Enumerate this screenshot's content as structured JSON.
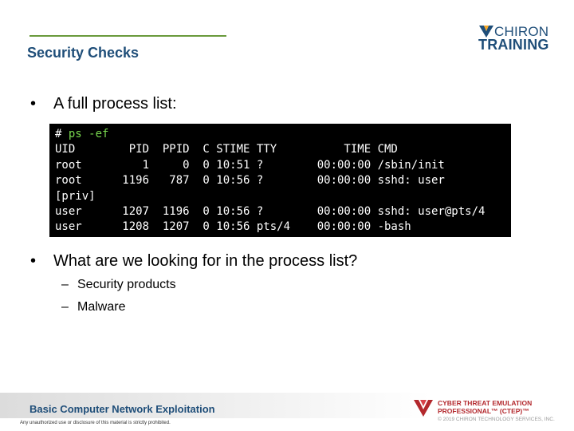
{
  "header": {
    "title": "Security Checks",
    "logo_line1": "CHIRON",
    "logo_line2": "TRAINING",
    "rule_color": "#6a9a3c",
    "title_color": "#1f4e79"
  },
  "bullets": [
    {
      "marker": "•",
      "text": "A full process list:"
    },
    {
      "marker": "•",
      "text": "What are we looking for in the process list?"
    }
  ],
  "sub_bullets": [
    {
      "marker": "–",
      "text": "Security products"
    },
    {
      "marker": "–",
      "text": "Malware"
    }
  ],
  "terminal": {
    "prompt": "# ",
    "command": "ps -ef",
    "lines": [
      "UID        PID  PPID  C STIME TTY          TIME CMD",
      "root         1     0  0 10:51 ?        00:00:00 /sbin/init",
      "root      1196   787  0 10:56 ?        00:00:00 sshd: user",
      "[priv]",
      "user      1207  1196  0 10:56 ?        00:00:00 sshd: user@pts/4",
      "user      1208  1207  0 10:56 pts/4    00:00:00 -bash"
    ]
  },
  "footer": {
    "course_title": "Basic Computer Network Exploitation",
    "disclaimer": "Any unauthorized use or disclosure of this material is strictly prohibited.",
    "ctep_line1": "CYBER THREAT EMULATION",
    "ctep_line2": "PROFESSIONAL™ (CTEP)™",
    "copyright": "© 2019 CHIRON TECHNOLOGY SERVICES, INC."
  }
}
